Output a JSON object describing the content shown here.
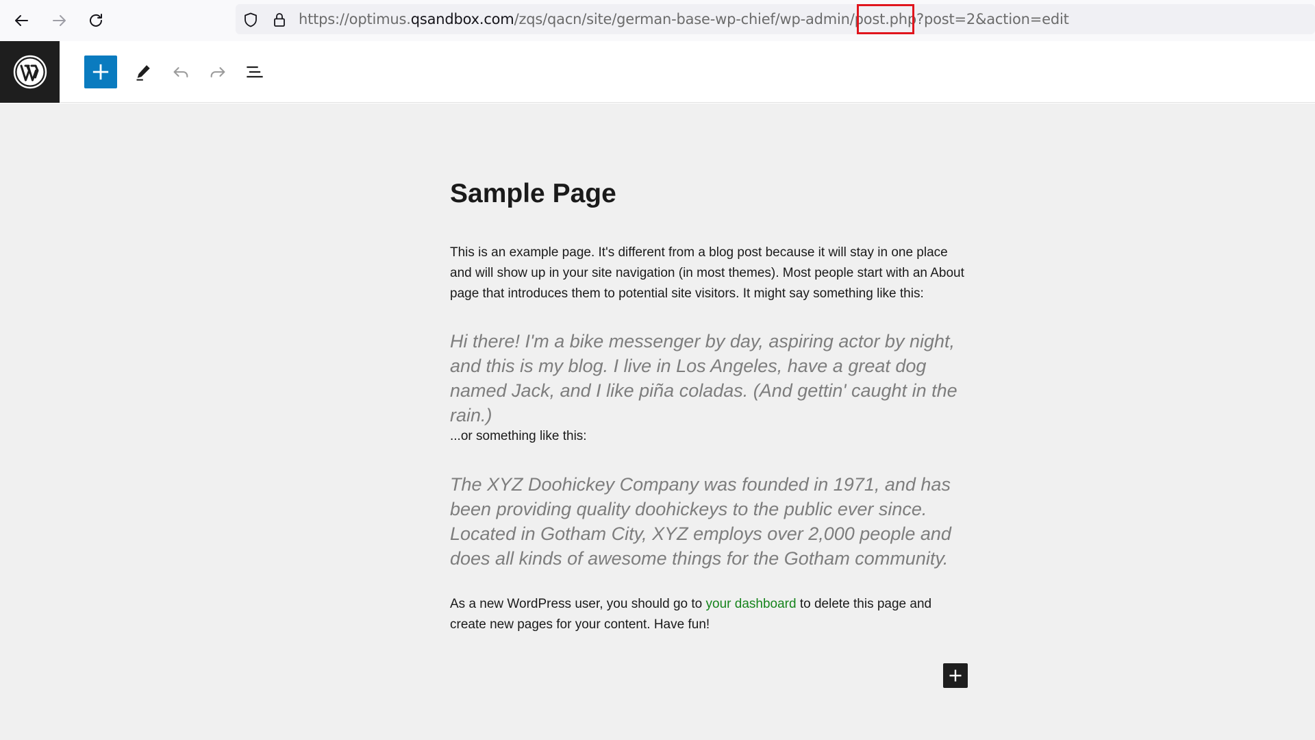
{
  "browser": {
    "back_icon": "arrow-left-icon",
    "forward_icon": "arrow-right-icon",
    "reload_icon": "reload-icon",
    "url_prefix": "https://optimus.",
    "url_host": "qsandbox.com",
    "url_path": "/zqs/qacn/site/german-base-wp-chief/wp-admin/post.php?post=2&action=edit",
    "highlight_color": "#e0151d"
  },
  "toolbar": {
    "logo_icon": "wordpress-logo-icon",
    "add_block_icon": "plus-icon",
    "tools_icon": "pencil-icon",
    "undo_icon": "undo-icon",
    "redo_icon": "redo-icon",
    "list_view_icon": "list-view-icon",
    "accent": "#0a7bbf"
  },
  "page": {
    "title": "Sample Page",
    "para1": "This is an example page. It's different from a blog post because it will stay in one place and will show up in your site navigation (in most themes). Most people start with an About page that introduces them to potential site visitors. It might say something like this:",
    "quote1": "Hi there! I'm a bike messenger by day, aspiring actor by night, and this is my blog. I live in Los Angeles, have a great dog named Jack, and I like piña coladas. (And gettin' caught in the rain.)",
    "para2": "...or something like this:",
    "quote2": "The XYZ Doohickey Company was founded in 1971, and has been providing quality doohickeys to the public ever since. Located in Gotham City, XYZ employs over 2,000 people and does all kinds of awesome things for the Gotham community.",
    "para3_before": "As a new WordPress user, you should go to ",
    "para3_link": "your dashboard",
    "para3_after": " to delete this page and create new pages for your content. Have fun!",
    "link_color": "#16841c"
  }
}
